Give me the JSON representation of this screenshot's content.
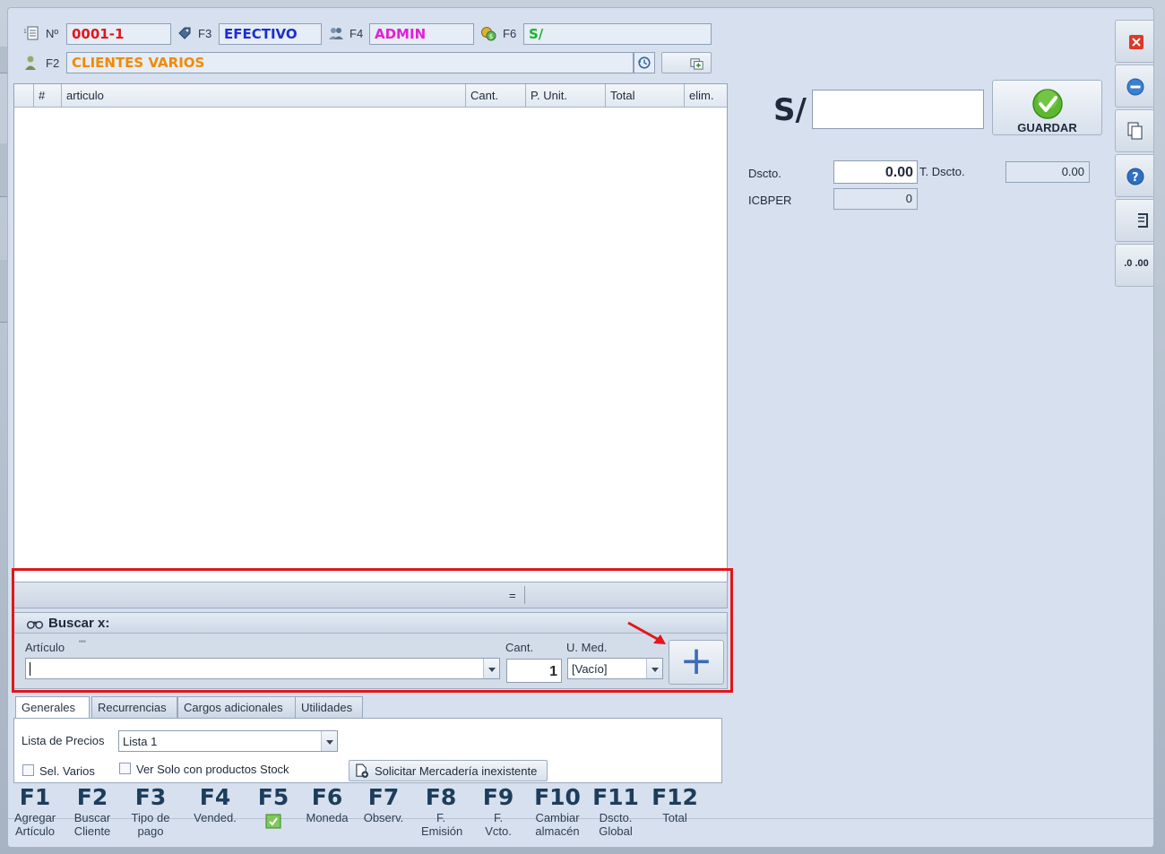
{
  "header": {
    "number_label": "Nº",
    "number_value": "0001-1",
    "payment_key": "F3",
    "payment_value": "EFECTIVO",
    "seller_key": "F4",
    "seller_value": "ADMIN",
    "currency_key": "F6",
    "currency_value": "S/",
    "client_key": "F2",
    "client_value": "CLIENTES VARIOS"
  },
  "grid": {
    "columns": [
      "#",
      "articulo",
      "Cant.",
      "P. Unit.",
      "Total",
      "elim."
    ],
    "rows": [],
    "footer_mark": "="
  },
  "search": {
    "title": "Buscar x:",
    "article_label": "Artículo",
    "article_hint": "\"\"",
    "article_value": "",
    "qty_label": "Cant.",
    "qty_value": "1",
    "unit_label": "U. Med.",
    "unit_value": "[Vacío]",
    "add_symbol": "+"
  },
  "tabs": [
    {
      "label": "Generales",
      "active": true
    },
    {
      "label": "Recurrencias",
      "active": false
    },
    {
      "label": "Cargos adicionales",
      "active": false
    },
    {
      "label": "Utilidades",
      "active": false
    }
  ],
  "generales": {
    "price_list_label": "Lista de Precios",
    "price_list_value": "Lista 1",
    "sel_varios_label": "Sel. Varios",
    "stock_only_label": "Ver Solo con productos Stock",
    "request_button_label": "Solicitar Mercadería inexistente"
  },
  "totals": {
    "currency_symbol": "S/",
    "amount_value": "",
    "save_label": "GUARDAR",
    "discount_label": "Dscto.",
    "discount_value": "0.00",
    "total_discount_label": "T. Dscto.",
    "total_discount_value": "0.00",
    "icbper_label": "ICBPER",
    "icbper_value": "0"
  },
  "side_buttons": {
    "decimals_label": ".0 .00"
  },
  "function_keys": [
    {
      "key": "F1",
      "desc": "Agregar Artículo"
    },
    {
      "key": "F2",
      "desc": "Buscar Cliente"
    },
    {
      "key": "F3",
      "desc": "Tipo de pago"
    },
    {
      "key": "F4",
      "desc": "Vended."
    },
    {
      "key": "F5",
      "desc": ""
    },
    {
      "key": "F6",
      "desc": "Moneda"
    },
    {
      "key": "F7",
      "desc": "Observ."
    },
    {
      "key": "F8",
      "desc": "F. Emisión"
    },
    {
      "key": "F9",
      "desc": "F. Vcto."
    },
    {
      "key": "F10",
      "desc": "Cambiar almacén"
    },
    {
      "key": "F11",
      "desc": "Dscto. Global"
    },
    {
      "key": "F12",
      "desc": "Total"
    }
  ],
  "colors": {
    "number": "#e0171c",
    "payment": "#1a2fcf",
    "seller": "#e020d8",
    "currency": "#18b52a",
    "client": "#f08a00",
    "annotation": "#e0171c"
  }
}
